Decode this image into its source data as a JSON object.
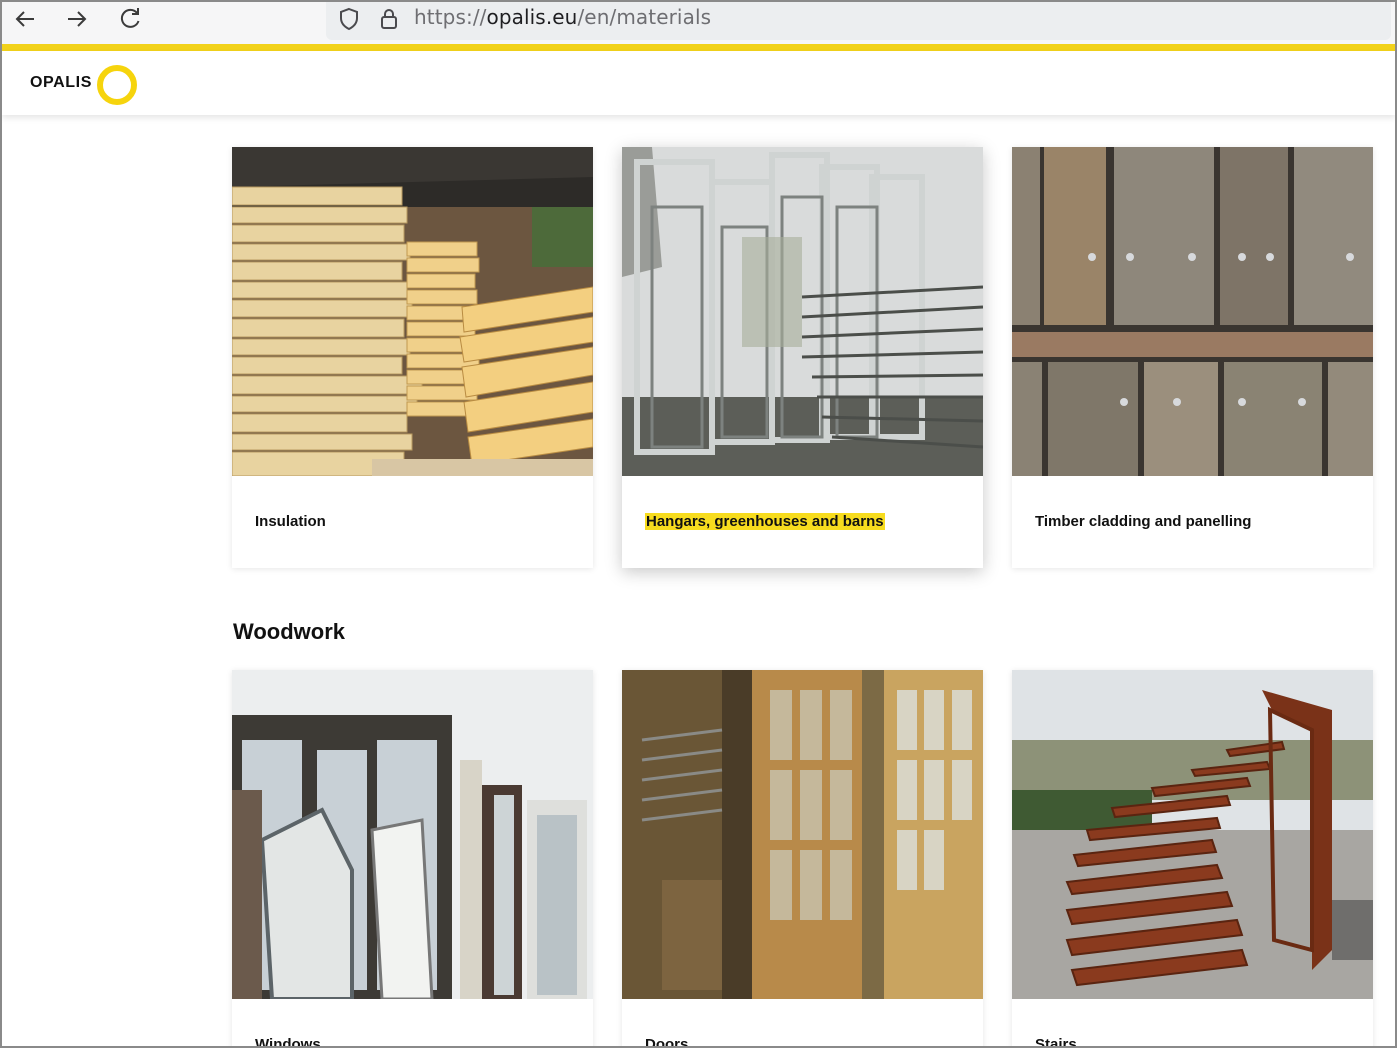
{
  "browser": {
    "url_prefix": "https://",
    "url_domain": "opalis.eu",
    "url_path": "/en/materials"
  },
  "site": {
    "logo_text": "OPALIS",
    "accent_color": "#f6d40d"
  },
  "row1": [
    {
      "label": "Insulation",
      "highlighted": false
    },
    {
      "label": "Hangars, greenhouses and barns",
      "highlighted": true
    },
    {
      "label": "Timber cladding and panelling",
      "highlighted": false
    }
  ],
  "section": {
    "title": "Woodwork"
  },
  "row2": [
    {
      "label": "Windows"
    },
    {
      "label": "Doors"
    },
    {
      "label": "Stairs"
    }
  ]
}
